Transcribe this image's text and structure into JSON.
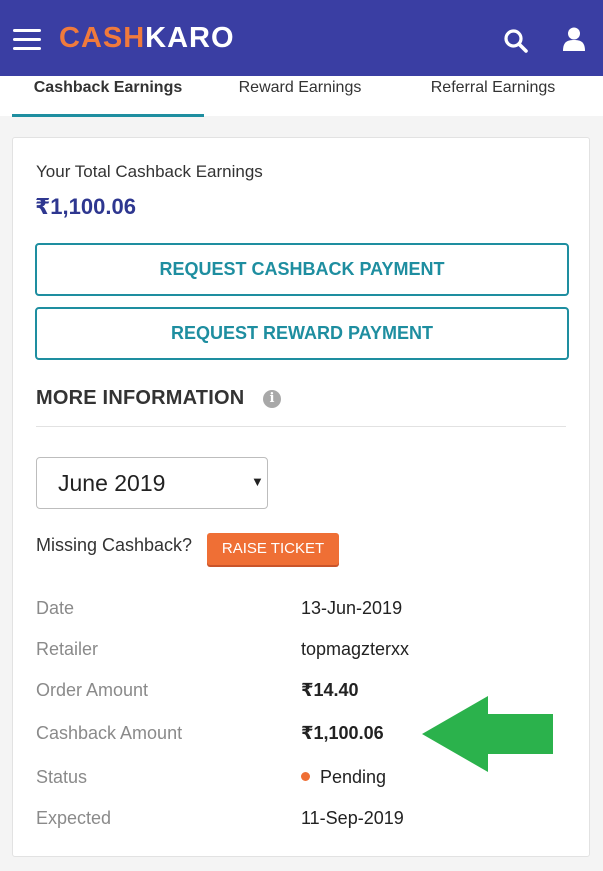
{
  "header": {
    "logo_part1": "CASH",
    "logo_part2": "KARO",
    "bg_color": "#3a3ea3",
    "accent_color": "#f07a3c"
  },
  "tabs": [
    {
      "label": "Cashback Earnings",
      "active": true
    },
    {
      "label": "Reward Earnings",
      "active": false
    },
    {
      "label": "Referral Earnings",
      "active": false
    }
  ],
  "summary": {
    "total_label": "Your Total Cashback Earnings",
    "total_amount": "₹1,100.06",
    "request_cashback_label": "REQUEST CASHBACK PAYMENT",
    "request_reward_label": "REQUEST REWARD PAYMENT"
  },
  "more_info": {
    "title": "MORE INFORMATION",
    "info_icon": "i",
    "selected_month": "June 2019",
    "missing_label": "Missing Cashback?",
    "raise_ticket_label": "RAISE TICKET"
  },
  "details": [
    {
      "label": "Date",
      "value": "13-Jun-2019"
    },
    {
      "label": "Retailer",
      "value": "topmagzterxx"
    },
    {
      "label": "Order Amount",
      "value": "₹14.40"
    },
    {
      "label": "Cashback Amount",
      "value": "₹1,100.06"
    },
    {
      "label": "Status",
      "value": "Pending"
    },
    {
      "label": "Expected",
      "value": "11-Sep-2019"
    }
  ],
  "colors": {
    "teal": "#1e8ea0",
    "orange": "#ef6f35",
    "arrow_green": "#2bb24c"
  }
}
